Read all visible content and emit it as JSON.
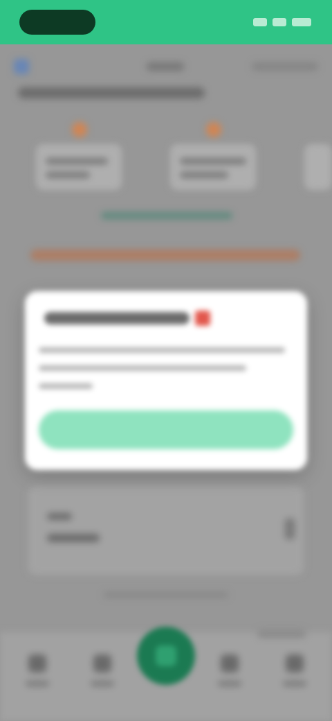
{
  "colors": {
    "accent": "#2fc486",
    "accent_dark": "#1b7a52",
    "dialog_button": "#8fe3bf",
    "overlay": "#9c9c9c",
    "title_flag": "#e2574c"
  },
  "status_bar": {},
  "modal": {
    "title": "",
    "body": "",
    "button_label": ""
  },
  "icons": {
    "title_badge": "red-flag-icon",
    "fab": "center-action-icon"
  }
}
